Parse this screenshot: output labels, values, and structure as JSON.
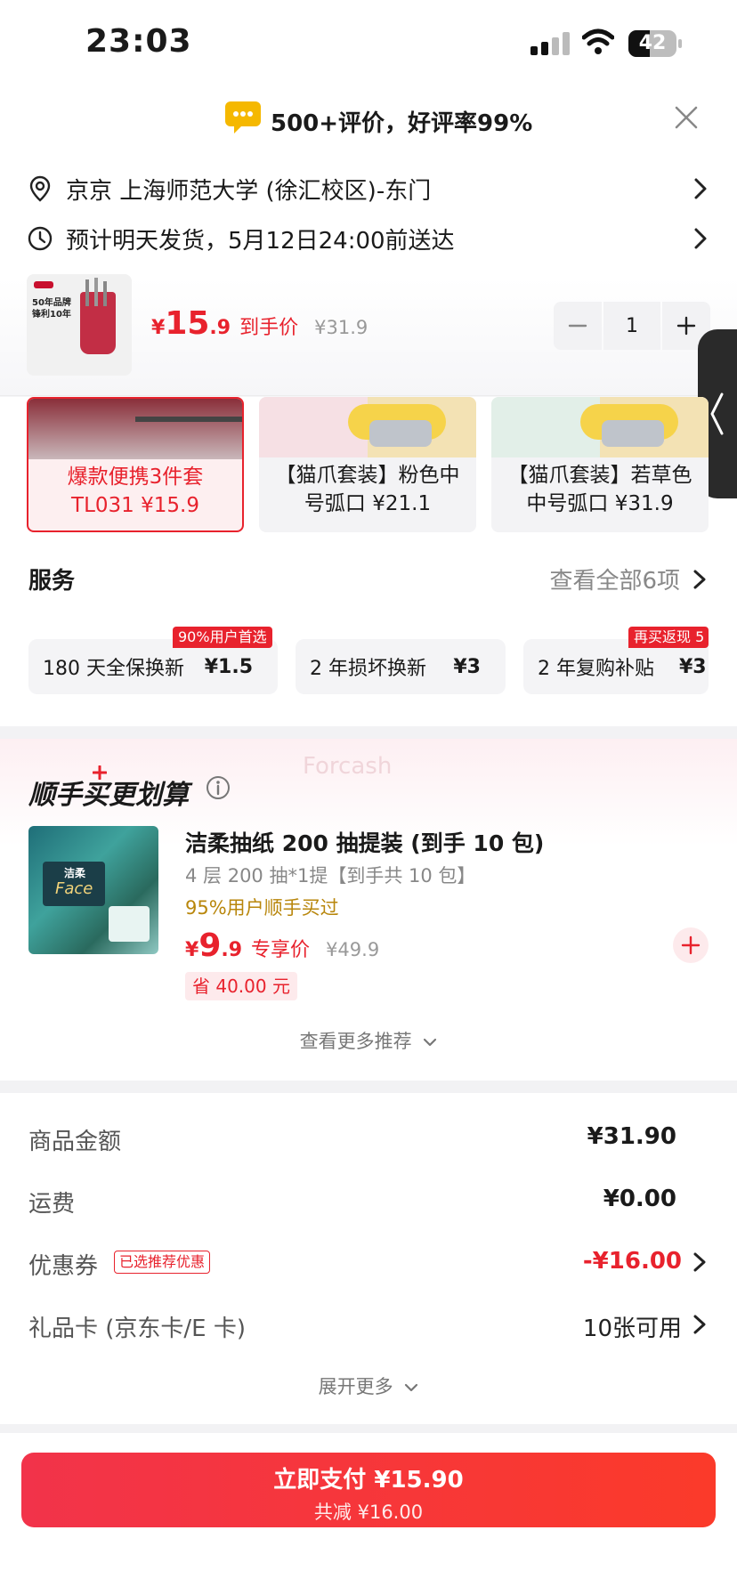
{
  "status_bar": {
    "time": "23:03",
    "battery": "42"
  },
  "rating": {
    "text": "500+评价，好评率99%"
  },
  "address": {
    "text": "京京  上海师范大学 (徐汇校区)-东门"
  },
  "delivery": {
    "text": "预计明天发货，5月12日24:00前送达"
  },
  "cart_item": {
    "thumb_text1": "50年品牌",
    "thumb_text2": "锋利10年",
    "currency": "¥",
    "price_int": "15",
    "price_dec": ".9",
    "price_label": "到手价",
    "original_price": "¥31.9",
    "quantity": "1"
  },
  "variants": [
    {
      "line1": "爆款便携3件套",
      "line2": "TL031 ¥15.9"
    },
    {
      "line1": "【猫爪套装】粉色中",
      "line2": "号弧口 ¥21.1"
    },
    {
      "line1": "【猫爪套装】若草色",
      "line2": "中号弧口 ¥31.9"
    }
  ],
  "services": {
    "title": "服务",
    "view_all": "查看全部6项",
    "items": [
      {
        "name": "180 天全保换新",
        "price": "¥1.5",
        "tag": "90%用户首选"
      },
      {
        "name": "2 年损坏换新",
        "price": "¥3",
        "tag": ""
      },
      {
        "name": "2 年复购补贴",
        "price": "¥3",
        "tag": "再买返现 5"
      }
    ]
  },
  "recommend": {
    "title": "顺手买更划算",
    "watermark": "Forcash",
    "product_title": "洁柔抽纸 200 抽提装 (到手 10 包)",
    "spec": "4 层 200 抽*1提【到手共 10 包】",
    "buyers": "95%用户顺手买过",
    "currency": "¥",
    "price_int": "9",
    "price_dec": ".9",
    "price_label": "专享价",
    "original_price": "¥49.9",
    "save": "省 40.00 元",
    "more": "查看更多推荐",
    "thumb_brand": "洁柔",
    "thumb_face": "Face"
  },
  "summary": {
    "goods_label": "商品金额",
    "goods_value": "¥31.90",
    "shipping_label": "运费",
    "shipping_value": "¥0.00",
    "coupon_label": "优惠券",
    "coupon_tag": "已选推荐优惠",
    "coupon_value": "-¥16.00",
    "giftcard_label": "礼品卡 (京东卡/E 卡)",
    "giftcard_value": "10张可用",
    "expand": "展开更多"
  },
  "pay": {
    "label": "立即支付 ¥15.90",
    "sub": "共减 ¥16.00"
  },
  "colors": {
    "accent": "#e8222d",
    "gold": "#b8860b",
    "chip_bg": "#f4f4f6"
  }
}
